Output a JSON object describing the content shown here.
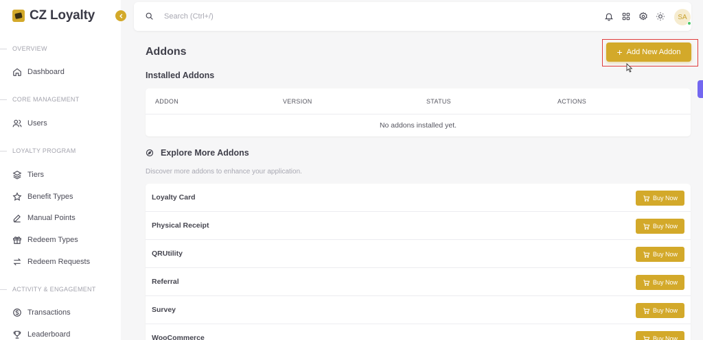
{
  "brand": {
    "name": "CZ Loyalty",
    "accent": "#d3a92a"
  },
  "sidebar": {
    "sections": [
      {
        "title": "OVERVIEW",
        "items": [
          {
            "label": "Dashboard",
            "icon": "home-icon"
          }
        ]
      },
      {
        "title": "CORE MANAGEMENT",
        "items": [
          {
            "label": "Users",
            "icon": "users-icon"
          }
        ]
      },
      {
        "title": "LOYALTY PROGRAM",
        "items": [
          {
            "label": "Tiers",
            "icon": "layers-icon"
          },
          {
            "label": "Benefit Types",
            "icon": "star-icon"
          },
          {
            "label": "Manual Points",
            "icon": "pencil-icon"
          },
          {
            "label": "Redeem Types",
            "icon": "gift-icon"
          },
          {
            "label": "Redeem Requests",
            "icon": "swap-icon"
          }
        ]
      },
      {
        "title": "ACTIVITY & ENGAGEMENT",
        "items": [
          {
            "label": "Transactions",
            "icon": "dollar-icon"
          },
          {
            "label": "Leaderboard",
            "icon": "trophy-icon"
          }
        ]
      }
    ]
  },
  "topbar": {
    "search_placeholder": "Search (Ctrl+/)",
    "avatar_initials": "SA"
  },
  "page": {
    "title": "Addons",
    "add_button_label": "Add New Addon",
    "installed_title": "Installed Addons",
    "table_headers": [
      "ADDON",
      "VERSION",
      "STATUS",
      "ACTIONS"
    ],
    "empty_message": "No addons installed yet.",
    "explore_title": "Explore More Addons",
    "explore_subtitle": "Discover more addons to enhance your application.",
    "buy_label": "Buy Now",
    "addons": [
      "Loyalty Card",
      "Physical Receipt",
      "QRUtility",
      "Referral",
      "Survey",
      "WooCommerce"
    ]
  }
}
